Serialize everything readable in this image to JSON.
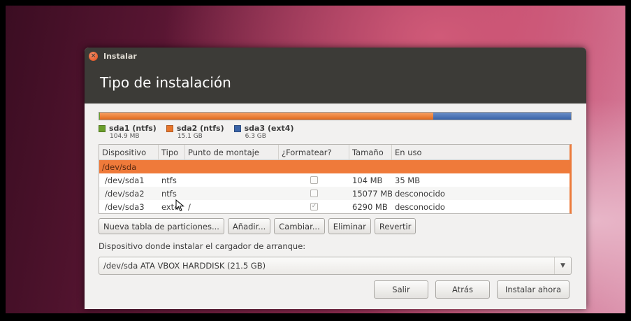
{
  "window": {
    "title": "Instalar"
  },
  "header": {
    "title": "Tipo de instalación"
  },
  "legend": [
    {
      "name": "sda1 (ntfs)",
      "size": "104.9 MB",
      "color": "#6a9e2a"
    },
    {
      "name": "sda2 (ntfs)",
      "size": "15.1 GB",
      "color": "#e8762c"
    },
    {
      "name": "sda3 (ext4)",
      "size": "6.3 GB",
      "color": "#3a64a8"
    }
  ],
  "table": {
    "headers": [
      "Dispositivo",
      "Tipo",
      "Punto de montaje",
      "¿Formatear?",
      "Tamaño",
      "En uso"
    ],
    "group": "/dev/sda",
    "rows": [
      {
        "device": "/dev/sda1",
        "type": "ntfs",
        "mount": "",
        "format": false,
        "size": "104 MB",
        "used": "35 MB"
      },
      {
        "device": "/dev/sda2",
        "type": "ntfs",
        "mount": "",
        "format": false,
        "size": "15077 MB",
        "used": "desconocido"
      },
      {
        "device": "/dev/sda3",
        "type": "ext4",
        "mount": "/",
        "format": true,
        "size": "6290 MB",
        "used": "desconocido"
      }
    ]
  },
  "buttons": {
    "new_table": "Nueva tabla de particiones...",
    "add": "Añadir...",
    "change": "Cambiar...",
    "delete": "Eliminar",
    "revert": "Revertir"
  },
  "bootloader": {
    "label": "Dispositivo donde instalar el cargador de arranque:",
    "selected": "/dev/sda   ATA VBOX HARDDISK (21.5 GB)"
  },
  "footer": {
    "quit": "Salir",
    "back": "Atrás",
    "install": "Instalar ahora"
  },
  "icons": {
    "close": "close-icon",
    "dropdown": "chevron-down-icon",
    "cursor": "mouse-pointer-icon"
  }
}
